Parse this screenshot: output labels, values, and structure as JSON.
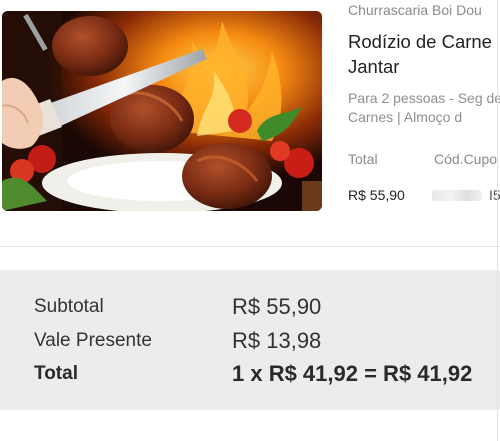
{
  "product": {
    "merchant": "Churrascaria Boi Dou",
    "title": "Rodízio de Carne Jantar",
    "description": "Para 2 pessoas - Seg de Carnes | Almoço d",
    "image_icon": "meat-skewer-image",
    "columns": {
      "total_header": "Total",
      "code_header": "Cód.Cupo",
      "total_value": "R$ 55,90",
      "code_tail": "I5"
    }
  },
  "summary": {
    "subtotal_label": "Subtotal",
    "subtotal_value": "R$ 55,90",
    "gift_label": "Vale Presente",
    "gift_value": "R$ 13,98",
    "total_label": "Total",
    "total_value": "1 x R$ 41,92 = R$ 41,92"
  },
  "colors": {
    "panel_bg": "#ececec",
    "text_primary": "#222222",
    "text_muted": "#8a8a8a"
  }
}
